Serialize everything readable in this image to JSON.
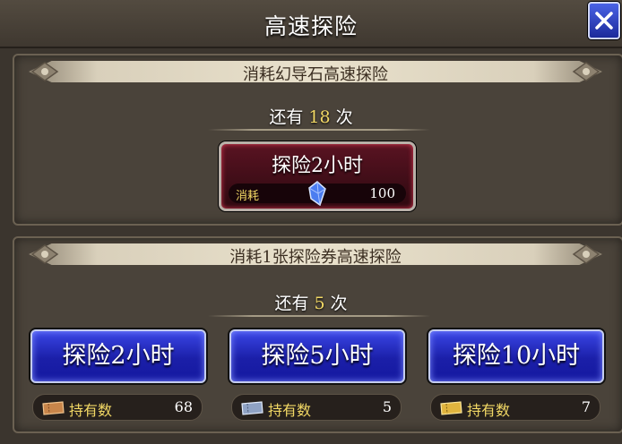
{
  "header": {
    "title": "高速探险",
    "close_icon": "close-x-icon"
  },
  "section1": {
    "banner": "消耗幻导石高速探险",
    "remaining": {
      "prefix": "还有",
      "count": "18",
      "suffix": "次"
    },
    "button": {
      "label": "探险2小时",
      "cost_label": "消耗",
      "cost_icon": "blue-crystal-icon",
      "cost_value": "100"
    }
  },
  "section2": {
    "banner": "消耗1张探险券高速探险",
    "remaining": {
      "prefix": "还有",
      "count": "5",
      "suffix": "次"
    },
    "owned_label": "持有数",
    "options": [
      {
        "label": "探险2小时",
        "ticket_icon": "bronze-ticket-icon",
        "owned": "68"
      },
      {
        "label": "探险5小时",
        "ticket_icon": "silver-ticket-icon",
        "owned": "5"
      },
      {
        "label": "探险10小时",
        "ticket_icon": "gold-ticket-icon",
        "owned": "7"
      }
    ]
  },
  "colors": {
    "accent_gold": "#f2d865",
    "button_blue": "#2a34d0",
    "button_red": "#5a1322"
  }
}
